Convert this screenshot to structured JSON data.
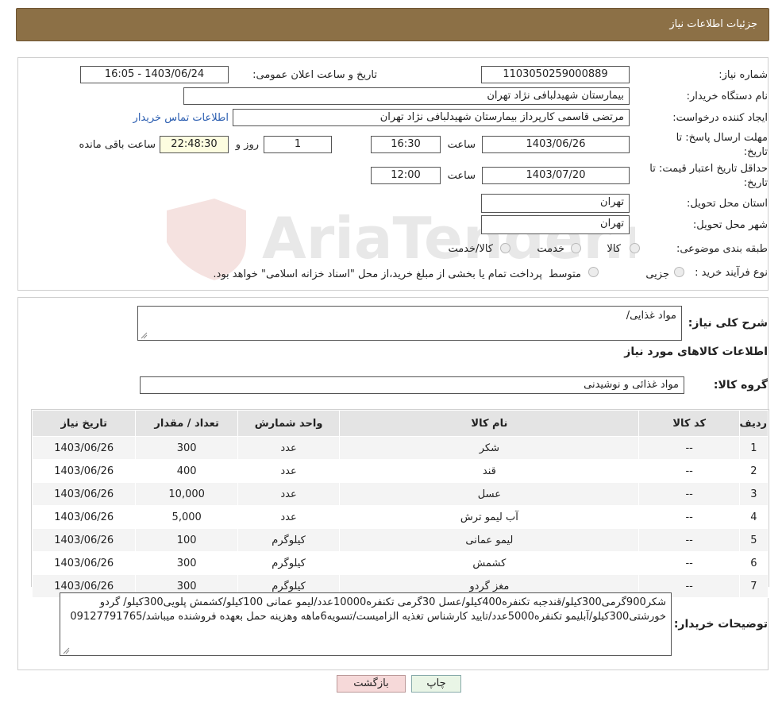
{
  "header": {
    "title": "جزئیات اطلاعات نیاز"
  },
  "form": {
    "need_number_label": "شماره نیاز:",
    "need_number": "1103050259000889",
    "announce_label": "تاریخ و ساعت اعلان عمومی:",
    "announce_value": "1403/06/24 - 16:05",
    "buyer_org_label": "نام دستگاه خریدار:",
    "buyer_org": "بیمارستان شهیدلبافی نژاد تهران",
    "requester_label": "ایجاد کننده درخواست:",
    "requester": "مرتضی  قاسمی کارپرداز بیمارستان شهیدلبافی نژاد تهران",
    "contact_link": "اطلاعات تماس خریدار",
    "deadline_label_1": "مهلت ارسال پاسخ: تا",
    "deadline_label_2": "تاریخ:",
    "deadline_date": "1403/06/26",
    "time_word": "ساعت",
    "deadline_time": "16:30",
    "days_value": "1",
    "days_word": "روز و",
    "remaining_time": "22:48:30",
    "remaining_word": "ساعت باقی مانده",
    "validity_label_1": "حداقل تاریخ اعتبار قیمت: تا",
    "validity_label_2": "تاریخ:",
    "validity_date": "1403/07/20",
    "validity_time": "12:00",
    "province_label": "استان محل تحویل:",
    "province": "تهران",
    "city_label": "شهر محل تحویل:",
    "city": "تهران",
    "category_label": "طبقه بندی موضوعی:",
    "category_options": [
      "کالا",
      "خدمت",
      "کالا/خدمت"
    ],
    "process_label": "نوع فرآیند خرید :",
    "process_options": [
      "جزیی",
      "متوسط"
    ],
    "process_note": "پرداخت تمام یا بخشی از مبلغ خرید،از محل \"اسناد خزانه اسلامی\" خواهد بود."
  },
  "details": {
    "summary_label": "شرح کلی نیاز:",
    "summary": "مواد غذایی/",
    "goods_info_title": "اطلاعات کالاهای مورد نیاز",
    "group_label": "گروه کالا:",
    "group": "مواد غذائی و نوشیدنی"
  },
  "table": {
    "headers": [
      "ردیف",
      "کد کالا",
      "نام کالا",
      "واحد شمارش",
      "تعداد / مقدار",
      "تاریخ نیاز"
    ],
    "rows": [
      [
        "1",
        "--",
        "شکر",
        "عدد",
        "300",
        "1403/06/26"
      ],
      [
        "2",
        "--",
        "قند",
        "عدد",
        "400",
        "1403/06/26"
      ],
      [
        "3",
        "--",
        "عسل",
        "عدد",
        "10,000",
        "1403/06/26"
      ],
      [
        "4",
        "--",
        "آب لیمو ترش",
        "عدد",
        "5,000",
        "1403/06/26"
      ],
      [
        "5",
        "--",
        "لیمو عمانی",
        "کیلوگرم",
        "100",
        "1403/06/26"
      ],
      [
        "6",
        "--",
        "کشمش",
        "کیلوگرم",
        "300",
        "1403/06/26"
      ],
      [
        "7",
        "--",
        "مغز گردو",
        "کیلوگرم",
        "300",
        "1403/06/26"
      ]
    ]
  },
  "notes": {
    "label": "توضیحات خریدار:",
    "text": "شکر900گرمی300کیلو/قندجبه تکنفره400کیلو/عسل 30گرمی تکنفره10000عدد/لیمو عمانی 100کیلو/کشمش پلویی300کیلو/ گردو خورشتی300کیلو/آبلیمو تکنفره5000عدد/تایید کارشناس تغذیه الزامیست/تسویه6ماهه وهزینه حمل بعهده فروشنده میباشد/09127791765"
  },
  "buttons": {
    "print": "چاپ",
    "back": "بازگشت"
  },
  "watermark": "AriaTender.neT"
}
